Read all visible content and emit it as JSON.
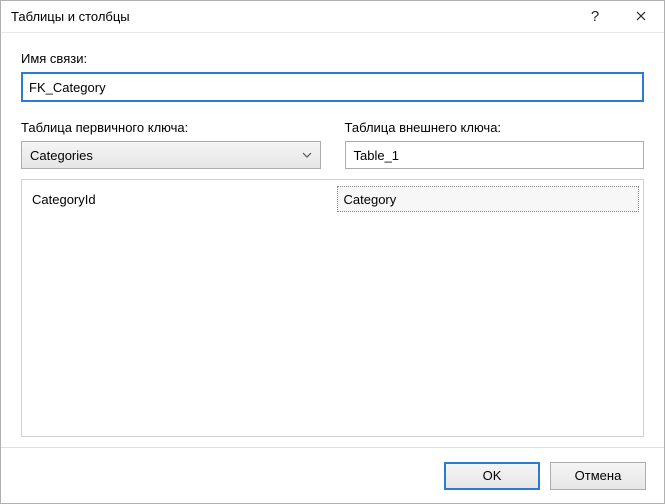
{
  "window": {
    "title": "Таблицы и столбцы"
  },
  "labels": {
    "relationship_name": "Имя связи:",
    "pk_table": "Таблица первичного ключа:",
    "fk_table": "Таблица внешнего ключа:"
  },
  "fields": {
    "relationship_name_value": "FK_Category",
    "pk_table_selected": "Categories",
    "fk_table_value": "Table_1"
  },
  "columns": {
    "pk_column": "CategoryId",
    "fk_column": "Category"
  },
  "buttons": {
    "ok": "OK",
    "cancel": "Отмена"
  },
  "icons": {
    "help": "?",
    "close": "✕"
  }
}
